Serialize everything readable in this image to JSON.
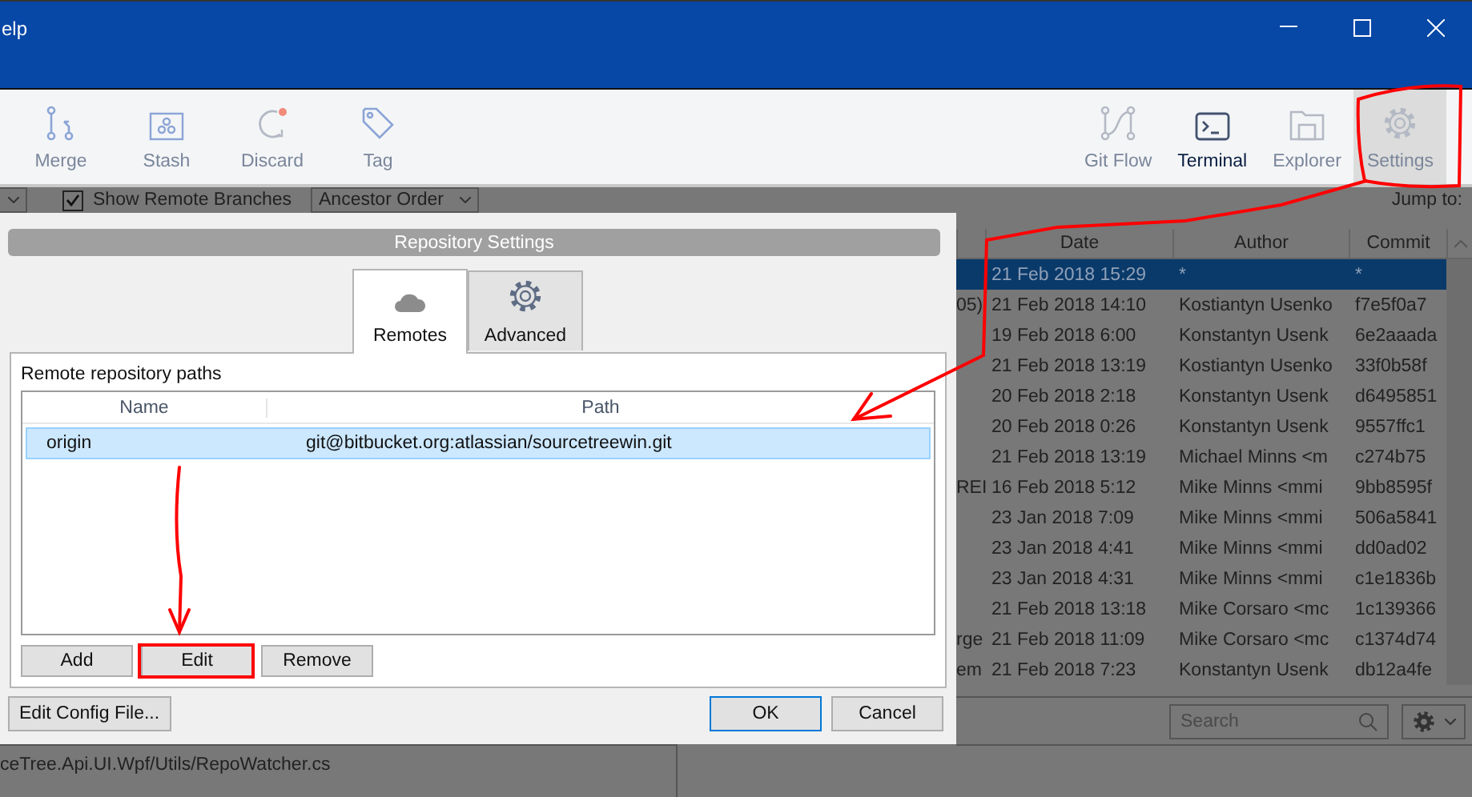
{
  "menu_bar": {
    "items": [
      {
        "label": "elp"
      }
    ]
  },
  "toolbar": {
    "left": [
      {
        "label": "Merge",
        "kind": "merge",
        "disabled": true,
        "selected": false
      },
      {
        "label": "Stash",
        "kind": "stash",
        "disabled": true,
        "selected": false
      },
      {
        "label": "Discard",
        "kind": "discard",
        "disabled": true,
        "selected": false
      },
      {
        "label": "Tag",
        "kind": "tag",
        "disabled": true,
        "selected": false
      }
    ],
    "right": [
      {
        "label": "Git Flow",
        "kind": "gitflow",
        "disabled": true,
        "selected": false
      },
      {
        "label": "Terminal",
        "kind": "terminal",
        "disabled": false,
        "selected": false
      },
      {
        "label": "Explorer",
        "kind": "explorer",
        "disabled": true,
        "selected": false
      },
      {
        "label": "Settings",
        "kind": "settings",
        "disabled": true,
        "selected": true
      }
    ]
  },
  "filter_bar": {
    "show_remote_branches": {
      "label": "Show Remote Branches",
      "checked": true
    },
    "order_dropdown": {
      "value": "Ancestor Order"
    },
    "jump_to": "Jump to:"
  },
  "commit_table": {
    "columns": [
      "Date",
      "Author",
      "Commit"
    ],
    "rows": [
      {
        "column_1": "",
        "date": "21 Feb 2018 15:29",
        "author": "*",
        "commit": "*",
        "selected": true
      },
      {
        "column_1": "05)",
        "date": "21 Feb 2018 14:10",
        "author": "Kostiantyn Usenko",
        "commit": "f7e5f0a7",
        "selected": false
      },
      {
        "column_1": "",
        "date": "19 Feb 2018 6:00",
        "author": "Konstantyn Usenk",
        "commit": "6e2aaada",
        "selected": false
      },
      {
        "column_1": "",
        "date": "21 Feb 2018 13:19",
        "author": "Kostiantyn Usenko",
        "commit": "33f0b58f",
        "selected": false
      },
      {
        "column_1": "",
        "date": "20 Feb 2018 2:18",
        "author": "Konstantyn Usenk",
        "commit": "d6495851",
        "selected": false
      },
      {
        "column_1": "",
        "date": "20 Feb 2018 0:26",
        "author": "Konstantyn Usenk",
        "commit": "9557ffc1",
        "selected": false
      },
      {
        "column_1": "",
        "date": "21 Feb 2018 13:19",
        "author": "Michael Minns <m",
        "commit": "c274b75",
        "selected": false
      },
      {
        "column_1": "REI",
        "date": "16 Feb 2018 5:12",
        "author": "Mike Minns <mmi",
        "commit": "9bb8595f",
        "selected": false
      },
      {
        "column_1": "",
        "date": "23 Jan 2018 7:09",
        "author": "Mike Minns <mmi",
        "commit": "506a5841",
        "selected": false
      },
      {
        "column_1": "",
        "date": "23 Jan 2018 4:41",
        "author": "Mike Minns <mmi",
        "commit": "dd0ad02",
        "selected": false
      },
      {
        "column_1": "",
        "date": "23 Jan 2018 4:31",
        "author": "Mike Minns <mmi",
        "commit": "c1e1836b",
        "selected": false
      },
      {
        "column_1": "",
        "date": "21 Feb 2018 13:18",
        "author": "Mike Corsaro <mc",
        "commit": "1c139366",
        "selected": false
      },
      {
        "column_1": "rge",
        "date": "21 Feb 2018 11:09",
        "author": "Mike Corsaro <mc",
        "commit": "c1374d74",
        "selected": false
      },
      {
        "column_1": "em",
        "date": "21 Feb 2018 7:23",
        "author": "Konstantyn Usenk",
        "commit": "db12a4fe",
        "selected": false
      }
    ]
  },
  "search": {
    "placeholder": "Search"
  },
  "file_list": {
    "items": [
      "ceTree.Api.UI.Wpf/Utils/RepoWatcher.cs"
    ]
  },
  "dialog": {
    "title": "Repository Settings",
    "tabs": [
      {
        "label": "Remotes",
        "kind": "remotes",
        "selected": true
      },
      {
        "label": "Advanced",
        "kind": "advanced",
        "selected": false
      }
    ],
    "group_label": "Remote repository paths",
    "remotes_table": {
      "columns": [
        "Name",
        "Path"
      ],
      "rows": [
        {
          "name": "origin",
          "path": "git@bitbucket.org:atlassian/sourcetreewin.git",
          "selected": true
        }
      ]
    },
    "list_buttons": [
      "Add",
      "Edit",
      "Remove"
    ],
    "config_button": "Edit Config File...",
    "buttons": [
      {
        "label": "OK",
        "default": true
      },
      {
        "label": "Cancel",
        "default": false
      }
    ]
  }
}
